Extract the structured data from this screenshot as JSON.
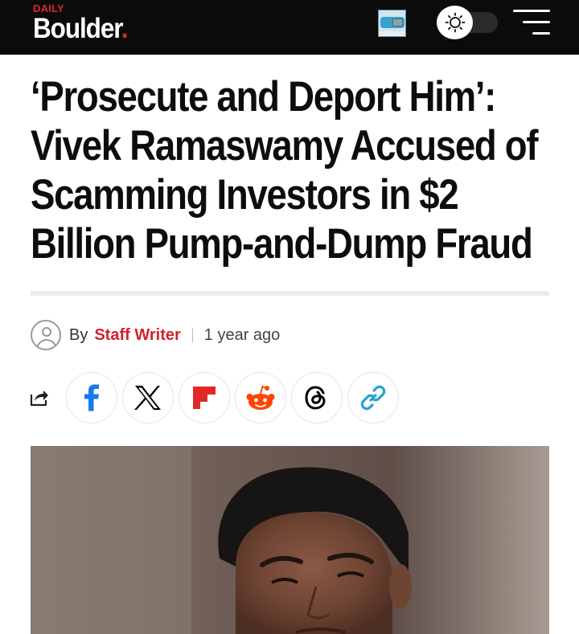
{
  "header": {
    "logo_small": "DAILY",
    "logo_main": "Boulder",
    "logo_dot": ".",
    "ad_thumbnail_icon": "ad-thumbnail-icon",
    "theme_toggle_icon": "sun-icon",
    "menu_icon": "hamburger-menu-icon"
  },
  "article": {
    "title_line1": "‘Prosecute and Deport Him’:",
    "title_line2": "Vivek Ramaswamy Accused of",
    "title_line3": "Scamming Investors in $2",
    "title_line4": "Billion Pump-and-Dump Fraud",
    "byline": {
      "by": "By",
      "author": "Staff Writer",
      "time": "1 year ago"
    },
    "share": {
      "items": [
        {
          "name": "facebook",
          "icon": "facebook-icon",
          "color": "#1877f2"
        },
        {
          "name": "x",
          "icon": "x-icon",
          "color": "#000000"
        },
        {
          "name": "flipboard",
          "icon": "flipboard-icon",
          "color": "#e12828"
        },
        {
          "name": "reddit",
          "icon": "reddit-icon",
          "color": "#ff4500"
        },
        {
          "name": "threads",
          "icon": "threads-icon",
          "color": "#000000"
        },
        {
          "name": "copy-link",
          "icon": "link-icon",
          "color": "#2a9fd6"
        }
      ]
    }
  },
  "colors": {
    "accent": "#e0242b",
    "header_bg": "#0b0b0b"
  }
}
